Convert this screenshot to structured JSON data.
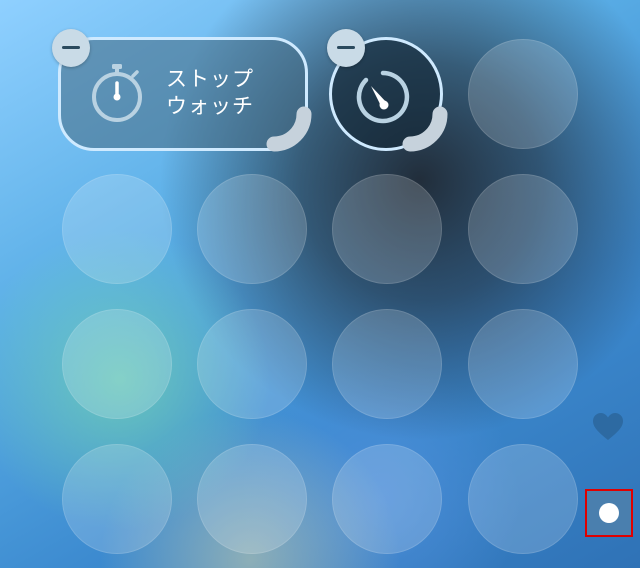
{
  "stopwatch_widget": {
    "label_line1": "ストップ",
    "label_line2": "ウォッチ"
  },
  "icons": {
    "remove": "minus-icon",
    "stopwatch": "stopwatch-icon",
    "dial": "stopwatch-dial-icon",
    "resize": "resize-handle-icon",
    "heart": "heart-icon",
    "record": "record-icon"
  },
  "colors": {
    "widget_border": "#cfeaff",
    "minus_badge": "#c9dbe7",
    "heart": "#2d6aa2",
    "highlight": "#e00000"
  }
}
